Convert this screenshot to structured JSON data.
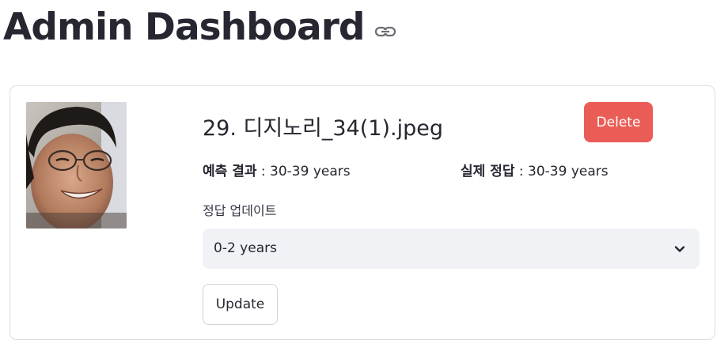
{
  "header": {
    "title": "Admin Dashboard",
    "anchor_icon": "link-icon"
  },
  "card": {
    "photo_icon": "face-photo",
    "file_title": "29. 디지노리_34(1).jpeg",
    "delete_label": "Delete",
    "prediction": {
      "label": "예측 결과",
      "value": " : 30-39 years"
    },
    "actual": {
      "label": "실제 정답",
      "value": " : 30-39 years"
    },
    "update_field": {
      "label": "정답 업데이트",
      "selected": "0-2 years",
      "chevron_icon": "chevron-down-icon"
    },
    "update_label": "Update"
  },
  "colors": {
    "delete_bg": "#ea5d56",
    "select_bg": "#f0f2f6",
    "text": "#262730"
  }
}
